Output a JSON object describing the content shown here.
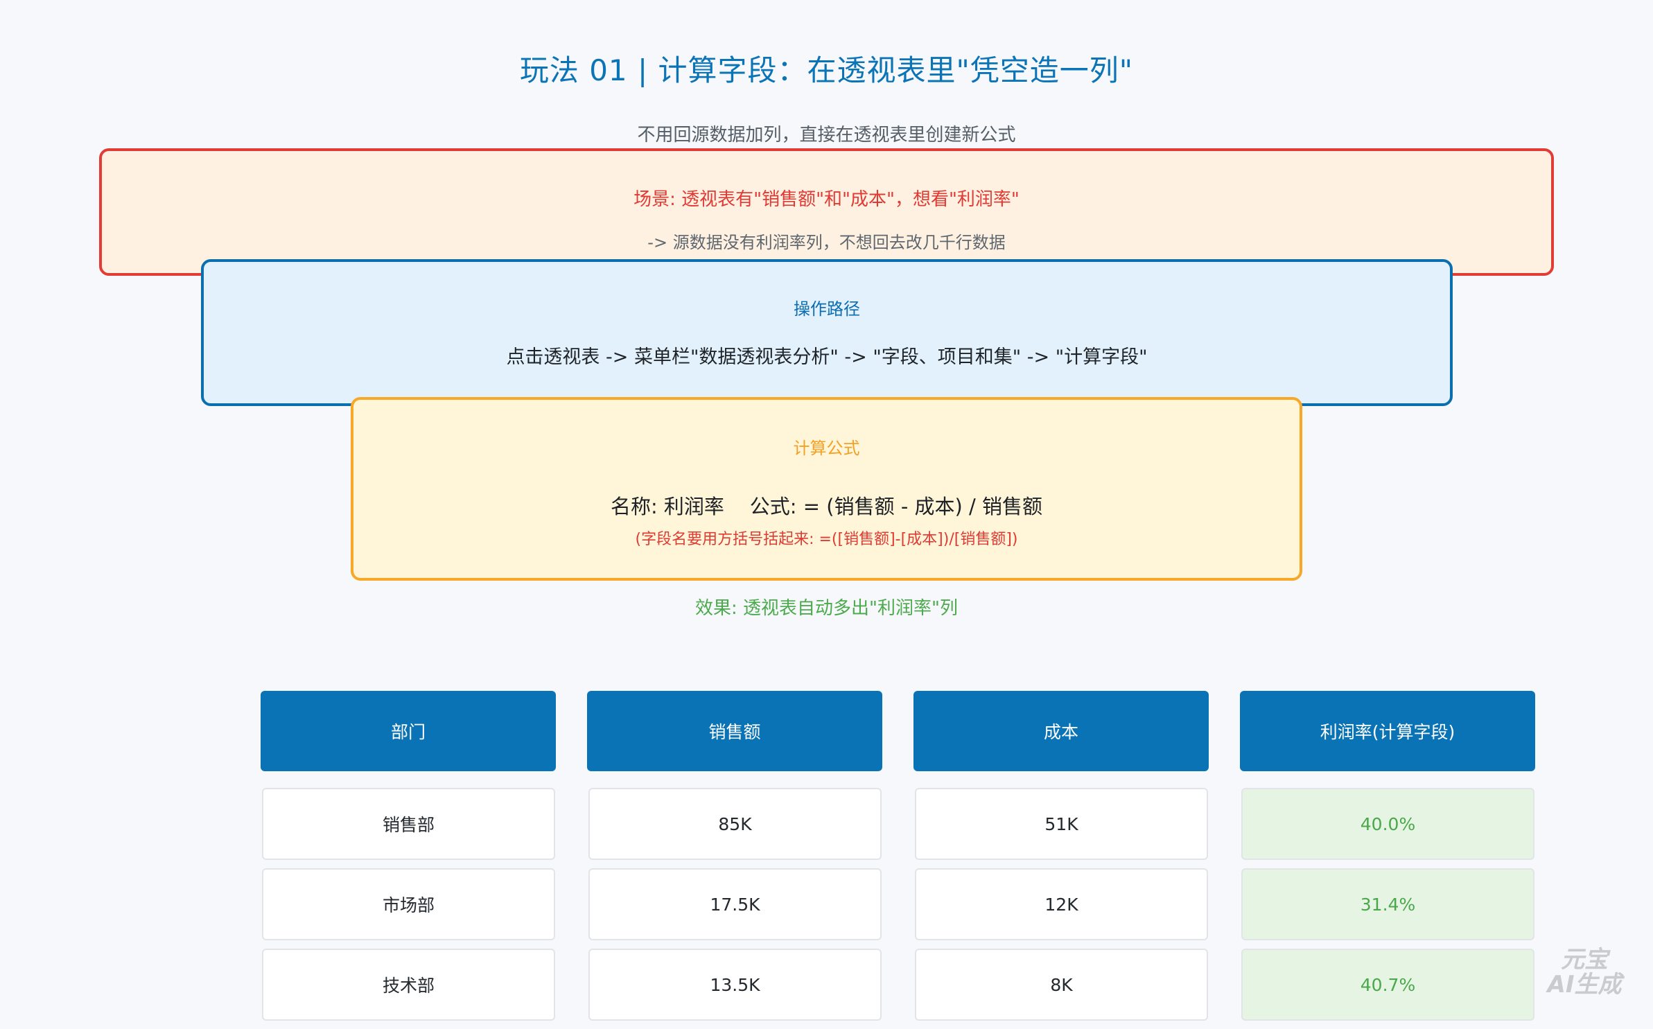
{
  "header": {
    "title": "玩法 01 | 计算字段：在透视表里\"凭空造一列\"",
    "subtitle": "不用回源数据加列，直接在透视表里创建新公式"
  },
  "scenario": {
    "title": "场景: 透视表有\"销售额\"和\"成本\"，想看\"利润率\"",
    "note": "-> 源数据没有利润率列，不想回去改几千行数据"
  },
  "path": {
    "title": "操作路径",
    "steps": "点击透视表 -> 菜单栏\"数据透视表分析\" -> \"字段、项目和集\" -> \"计算字段\""
  },
  "formula": {
    "title": "计算公式",
    "main": "名称: 利润率    公式: = (销售额 - 成本) / 销售额",
    "note": "(字段名要用方括号括起来: =([销售额]-[成本])/[销售额])"
  },
  "effect": "效果: 透视表自动多出\"利润率\"列",
  "table": {
    "headers": [
      "部门",
      "销售额",
      "成本",
      "利润率(计算字段)"
    ],
    "rows": [
      [
        "销售部",
        "85K",
        "51K",
        "40.0%"
      ],
      [
        "市场部",
        "17.5K",
        "12K",
        "31.4%"
      ],
      [
        "技术部",
        "13.5K",
        "8K",
        "40.7%"
      ]
    ]
  },
  "watermark": {
    "line1": "元宝",
    "line2": "AI生成"
  },
  "colors": {
    "accent_blue": "#0a73b6",
    "scenario_border": "#e23c36",
    "formula_border": "#f6a826",
    "effect_green": "#4caa4c"
  }
}
